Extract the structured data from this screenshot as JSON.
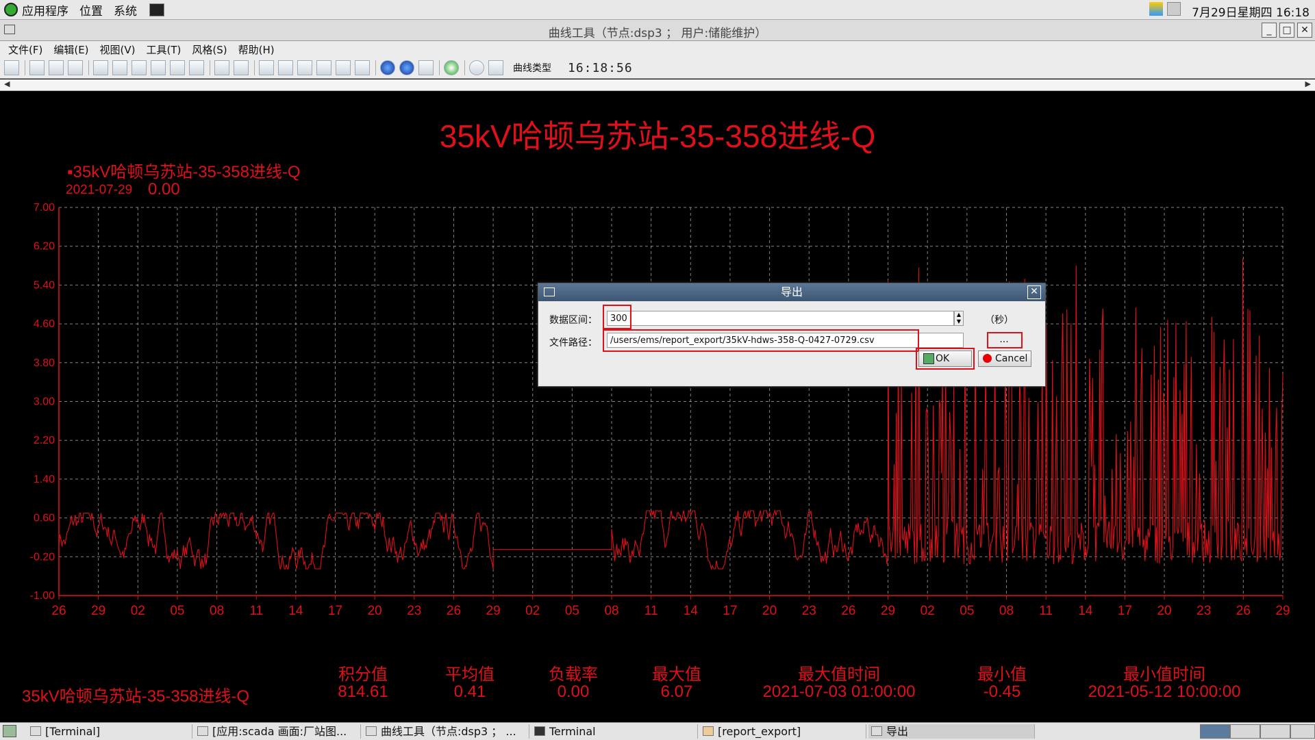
{
  "topbar": {
    "menus": [
      "应用程序",
      "位置",
      "系统"
    ],
    "clock": "7月29日星期四 16:18"
  },
  "window": {
    "title": "曲线工具（节点:dsp3 ； 用户:储能维护）"
  },
  "menubar": [
    "文件(F)",
    "编辑(E)",
    "视图(V)",
    "工具(T)",
    "风格(S)",
    "帮助(H)"
  ],
  "toolbar": {
    "curve_type_label": "曲线类型",
    "time": "16:18:56"
  },
  "chart": {
    "title": "35kV哈顿乌苏站-35-358进线-Q",
    "legend_series": "35kV哈顿乌苏站-35-358进线-Q",
    "legend_date": "2021-07-29",
    "legend_value": "0.00"
  },
  "chart_data": {
    "type": "line",
    "title": "35kV哈顿乌苏站-35-358进线-Q",
    "ylim": [
      -1.0,
      7.0
    ],
    "yticks": [
      "7.00",
      "6.20",
      "5.40",
      "4.60",
      "3.80",
      "3.00",
      "2.20",
      "1.40",
      "0.60",
      "-0.20",
      "-1.00"
    ],
    "xticks": [
      "26",
      "29",
      "02",
      "05",
      "08",
      "11",
      "14",
      "17",
      "20",
      "23",
      "26",
      "29",
      "02",
      "05",
      "08",
      "11",
      "14",
      "17",
      "20",
      "23",
      "26",
      "29",
      "02",
      "05",
      "08",
      "11",
      "14",
      "17",
      "20",
      "23",
      "26",
      "29"
    ],
    "grid": true,
    "series": [
      {
        "name": "35kV哈顿乌苏站-35-358进线-Q",
        "color": "#e0101a",
        "segments": [
          {
            "from_tick": 0,
            "to_tick": 11,
            "low": -0.45,
            "high": 0.7,
            "note_flat": false
          },
          {
            "from_tick": 11,
            "to_tick": 14,
            "flat_value": -0.05
          },
          {
            "from_tick": 14,
            "to_tick": 21,
            "low": -0.45,
            "high": 0.75
          },
          {
            "from_tick": 21,
            "to_tick": 31,
            "low": -0.45,
            "high": 6.07
          }
        ]
      }
    ]
  },
  "stats": {
    "name": "35kV哈顿乌苏站-35-358进线-Q",
    "items": [
      {
        "label": "积分值",
        "value": "814.61"
      },
      {
        "label": "平均值",
        "value": "0.41"
      },
      {
        "label": "负载率",
        "value": "0.00"
      },
      {
        "label": "最大值",
        "value": "6.07"
      },
      {
        "label": "最大值时间",
        "value": "2021-07-03 01:00:00"
      },
      {
        "label": "最小值",
        "value": "-0.45"
      },
      {
        "label": "最小值时间",
        "value": "2021-05-12 10:00:00"
      }
    ]
  },
  "dialog": {
    "title": "导出",
    "interval_label": "数据区间：",
    "interval_value": "300",
    "interval_unit": "（秒）",
    "path_label": "文件路径：",
    "path_value": "/users/ems/report_export/35kV-hdws-358-Q-0427-0729.csv",
    "browse_label": "...",
    "ok_label": "OK",
    "cancel_label": "Cancel"
  },
  "taskbar": [
    {
      "label": "[Terminal]"
    },
    {
      "label": "[应用:scada  画面:厂站图..."
    },
    {
      "label": "曲线工具（节点:dsp3 ； ..."
    },
    {
      "label": "Terminal"
    },
    {
      "label": "[report_export]"
    },
    {
      "label": "导出"
    }
  ]
}
